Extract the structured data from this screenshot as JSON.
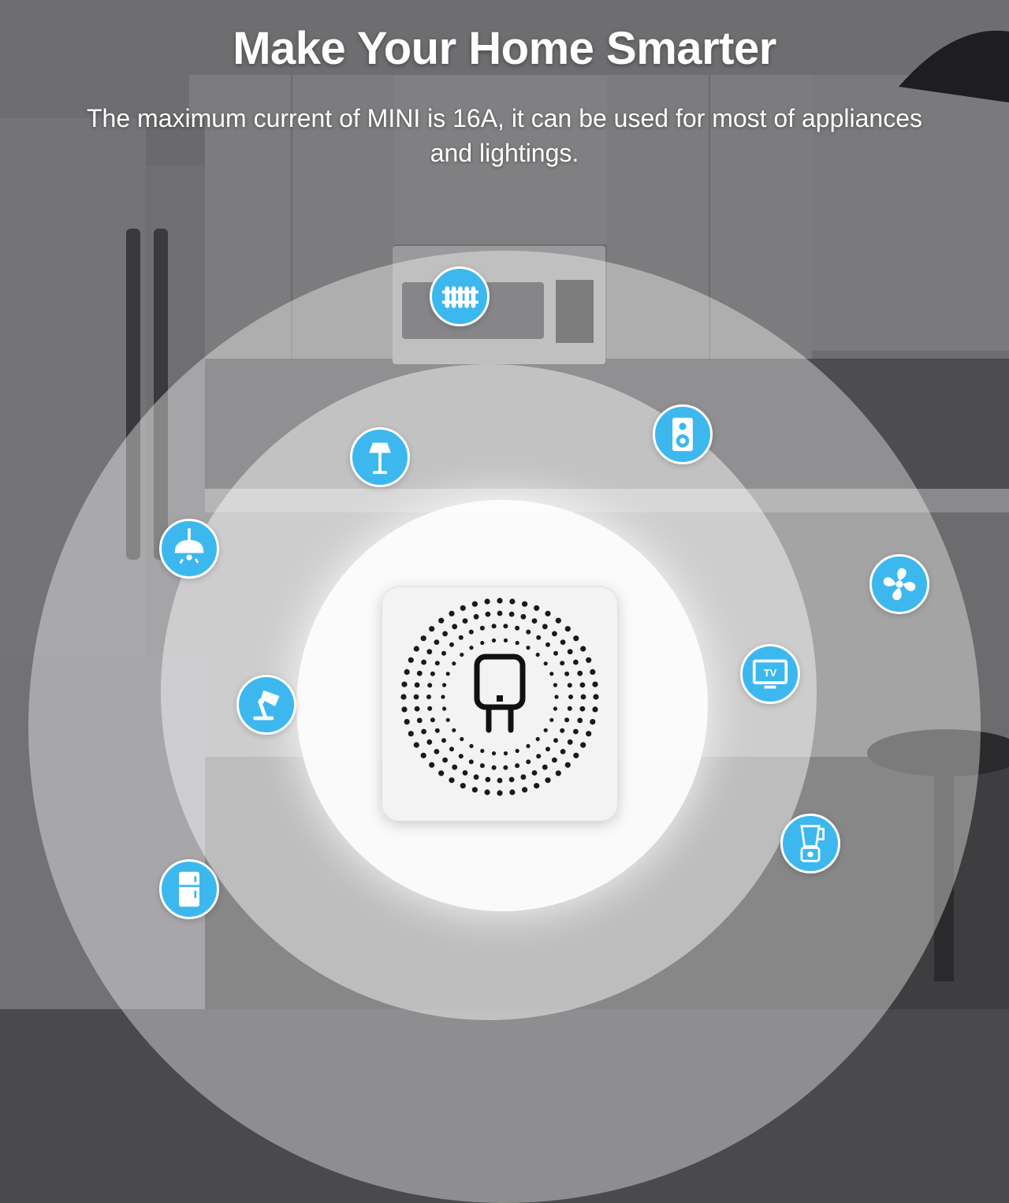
{
  "header": {
    "title": "Make Your Home Smarter",
    "subtitle": "The maximum current of MINI is 16A, it can be used for most of appliances and lightings."
  },
  "device": {
    "name": "mini-switch",
    "icon": "plug-icon"
  },
  "appliance_icons": [
    "radiator-icon",
    "floor-lamp-icon",
    "speaker-icon",
    "pendant-lamp-icon",
    "fan-icon",
    "tv-icon",
    "desk-lamp-icon",
    "blender-icon",
    "refrigerator-icon"
  ],
  "tv_icon_label": "TV",
  "colors": {
    "accent": "#3cb8ef",
    "badge_border": "#ffffff",
    "device_body": "#f3f3f3",
    "device_holes": "#1a1a1a"
  }
}
